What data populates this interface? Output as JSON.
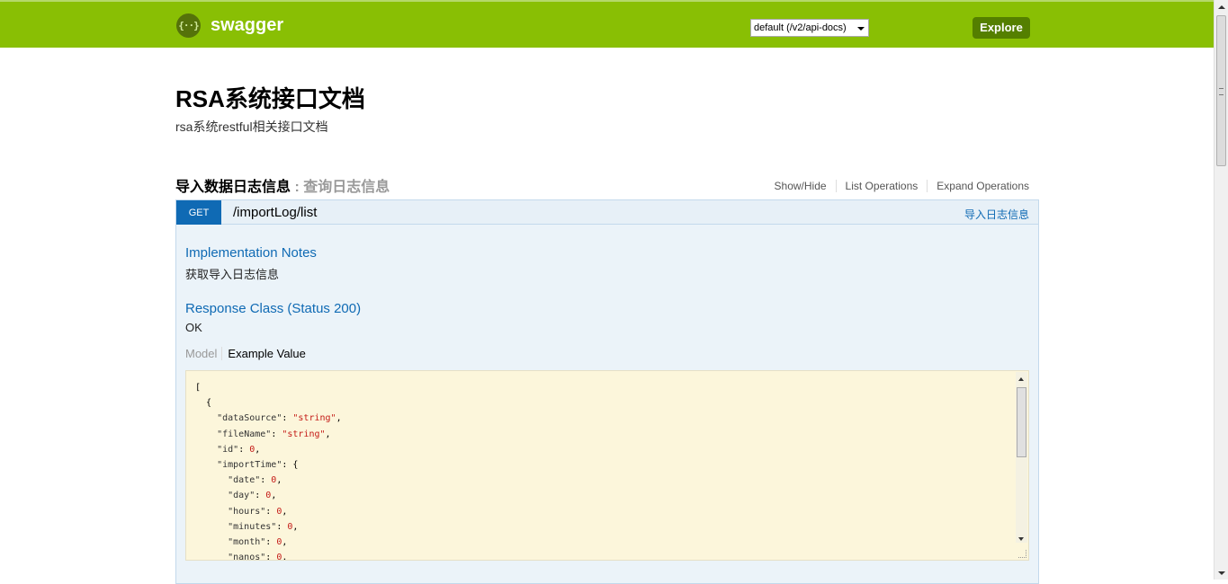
{
  "header": {
    "logo_glyph": "{··}",
    "logo_text": "swagger",
    "api_select_value": "default (/v2/api-docs)",
    "explore_label": "Explore",
    "bg_color": "#89bf04"
  },
  "info": {
    "title": "RSA系统接口文档",
    "description": "rsa系统restful相关接口文档"
  },
  "resource": {
    "name": "导入数据日志信息",
    "separator": " : ",
    "description": "查询日志信息",
    "links": [
      "Show/Hide",
      "List Operations",
      "Expand Operations"
    ]
  },
  "operation": {
    "method": "GET",
    "path": "/importLog/list",
    "tag": "导入日志信息",
    "method_color": "#0f6ab4",
    "impl_notes_heading": "Implementation Notes",
    "impl_notes_text": "获取导入日志信息",
    "response_class_heading": "Response Class (Status 200)",
    "response_class_text": "OK",
    "model_tab": "Model",
    "example_tab": "Example Value",
    "example_lines": [
      "[",
      "  {",
      "    \"dataSource\": \"string\",",
      "    \"fileName\": \"string\",",
      "    \"id\": 0,",
      "    \"importTime\": {",
      "      \"date\": 0,",
      "      \"day\": 0,",
      "      \"hours\": 0,",
      "      \"minutes\": 0,",
      "      \"month\": 0,",
      "      \"nanos\": 0,"
    ]
  }
}
